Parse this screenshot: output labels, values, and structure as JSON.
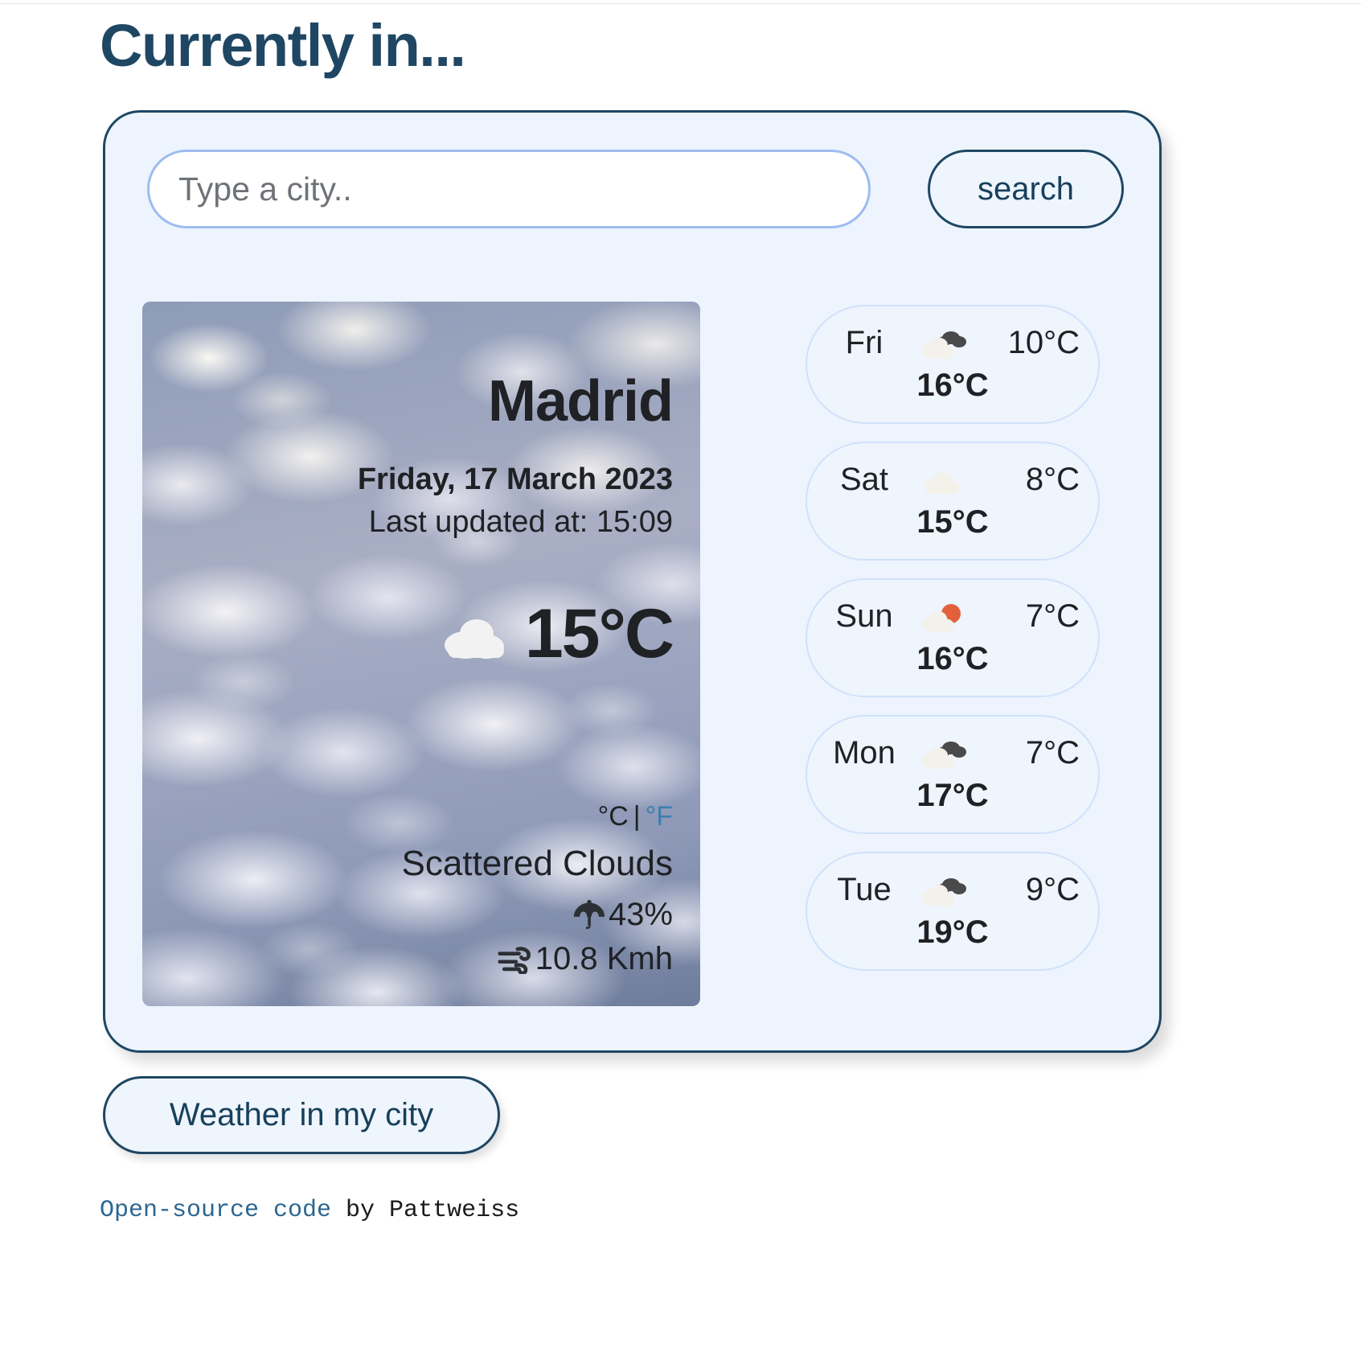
{
  "page": {
    "title": "Currently in..."
  },
  "search": {
    "placeholder": "Type a city..",
    "value": "",
    "button_label": "search"
  },
  "current": {
    "city": "Madrid",
    "date": "Friday, 17 March 2023",
    "last_updated": "Last updated at: 15:09",
    "temperature": "15°C",
    "icon": "cloud-icon",
    "units": {
      "celsius_label": "°C",
      "separator": "|",
      "fahrenheit_label": "°F",
      "active": "celsius"
    },
    "condition": "Scattered Clouds",
    "humidity": {
      "icon": "umbrella-icon",
      "value": "43%"
    },
    "wind": {
      "icon": "wind-icon",
      "value": "10.8 Kmh"
    }
  },
  "forecast": [
    {
      "day": "Fri",
      "icon": "broken-clouds-icon",
      "min": "10°C",
      "max": "16°C"
    },
    {
      "day": "Sat",
      "icon": "cloud-icon",
      "min": "8°C",
      "max": "15°C"
    },
    {
      "day": "Sun",
      "icon": "sun-behind-cloud-icon",
      "min": "7°C",
      "max": "16°C"
    },
    {
      "day": "Mon",
      "icon": "broken-clouds-icon",
      "min": "7°C",
      "max": "17°C"
    },
    {
      "day": "Tue",
      "icon": "broken-clouds-icon",
      "min": "9°C",
      "max": "19°C"
    }
  ],
  "geolocation_button": {
    "label": "Weather in my city"
  },
  "footer": {
    "link_text": "Open-source code",
    "rest_text": " by Pattweiss"
  },
  "colors": {
    "title_navy": "#1f4763",
    "card_bg": "#edf4fd",
    "card_border": "#1f4763",
    "input_border": "#9dbcf0",
    "forecast_border": "#cfe2fb",
    "link_blue": "#2c6691",
    "unit_inactive": "#3e7fae",
    "sun_orange": "#e2603c",
    "cloud_light": "#f4f1ea",
    "cloud_dark": "#4a4a4a"
  }
}
